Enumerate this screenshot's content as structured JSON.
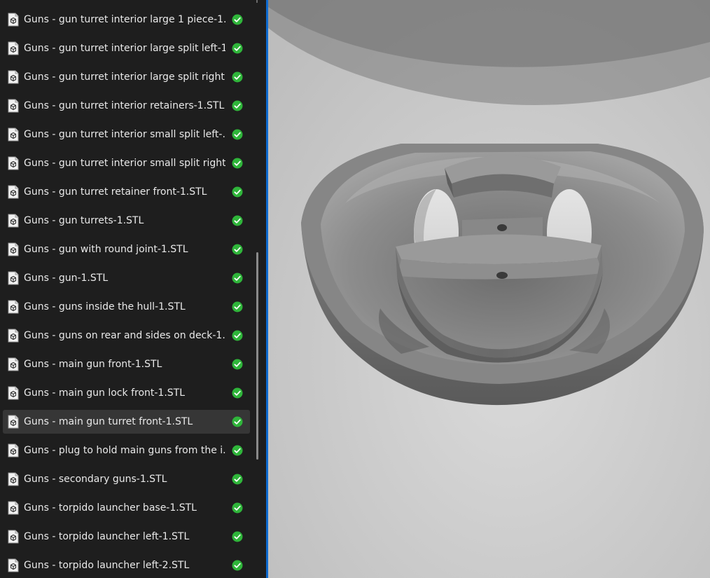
{
  "file_list": {
    "items": [
      {
        "name": "Guns - gun turret interior large 1 piece-1....",
        "selected": false
      },
      {
        "name": "Guns - gun turret interior large split left-1...",
        "selected": false
      },
      {
        "name": "Guns - gun turret interior large split right...",
        "selected": false
      },
      {
        "name": "Guns - gun turret interior retainers-1.STL",
        "selected": false
      },
      {
        "name": "Guns - gun turret interior small split left-...",
        "selected": false
      },
      {
        "name": "Guns - gun turret interior small split right...",
        "selected": false
      },
      {
        "name": "Guns - gun turret retainer front-1.STL",
        "selected": false
      },
      {
        "name": "Guns - gun turrets-1.STL",
        "selected": false
      },
      {
        "name": "Guns - gun with round joint-1.STL",
        "selected": false
      },
      {
        "name": "Guns - gun-1.STL",
        "selected": false
      },
      {
        "name": "Guns - guns inside the hull-1.STL",
        "selected": false
      },
      {
        "name": "Guns - guns on rear and sides on deck-1....",
        "selected": false
      },
      {
        "name": "Guns - main gun front-1.STL",
        "selected": false
      },
      {
        "name": "Guns - main gun lock front-1.STL",
        "selected": false
      },
      {
        "name": "Guns - main gun turret front-1.STL",
        "selected": true
      },
      {
        "name": "Guns - plug to hold main guns from the i...",
        "selected": false
      },
      {
        "name": "Guns - secondary guns-1.STL",
        "selected": false
      },
      {
        "name": "Guns - torpido launcher base-1.STL",
        "selected": false
      },
      {
        "name": "Guns - torpido launcher left-1.STL",
        "selected": false
      },
      {
        "name": "Guns - torpido launcher left-2.STL",
        "selected": false
      }
    ],
    "file_icon": "stl-file-icon",
    "status_icon": "sync-check-icon",
    "status_color": "#2fb53a"
  },
  "colors": {
    "panel_bg": "#1e1e1e",
    "selected_row": "#363636",
    "divider": "#0d6ad0",
    "model_gray": "#7a7a7a"
  }
}
